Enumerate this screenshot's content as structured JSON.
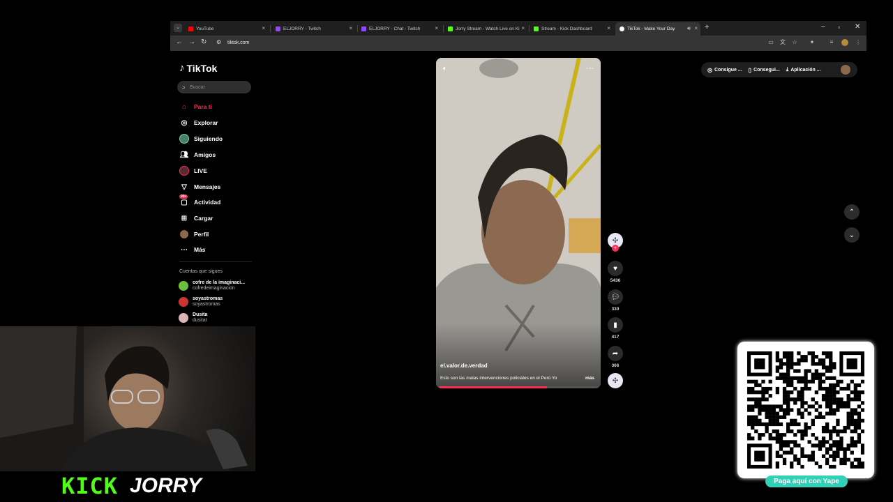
{
  "browser": {
    "tabs": [
      {
        "title": "YouTube",
        "color": "#ff0000",
        "active": false
      },
      {
        "title": "ELJORRY - Twitch",
        "color": "#9146ff",
        "active": false
      },
      {
        "title": "ELJORRY - Chat - Twitch",
        "color": "#9146ff",
        "active": false
      },
      {
        "title": "Jorry Stream - Watch Live on Ki",
        "color": "#53fc18",
        "active": false
      },
      {
        "title": "Stream - Kick Dashboard",
        "color": "#53fc18",
        "active": false
      },
      {
        "title": "TikTok - Make Your Day",
        "color": "#ffffff",
        "active": true
      }
    ],
    "new_tab": "+",
    "url": "tiktok.com"
  },
  "tiktok": {
    "logo_text": "TikTok",
    "search_placeholder": "Buscar",
    "nav": [
      {
        "label": "Para ti",
        "icon": "home-icon",
        "active": true
      },
      {
        "label": "Explorar",
        "icon": "compass-icon",
        "active": false
      },
      {
        "label": "Siguiendo",
        "icon": "following-avatar-icon",
        "active": false
      },
      {
        "label": "Amigos",
        "icon": "friends-icon",
        "active": false
      },
      {
        "label": "LIVE",
        "icon": "live-icon",
        "active": false
      },
      {
        "label": "Mensajes",
        "icon": "messages-icon",
        "active": false
      },
      {
        "label": "Actividad",
        "icon": "activity-icon",
        "active": false,
        "badge": "99+"
      },
      {
        "label": "Cargar",
        "icon": "upload-icon",
        "active": false
      },
      {
        "label": "Perfil",
        "icon": "profile-icon",
        "active": false
      },
      {
        "label": "Más",
        "icon": "more-dots-icon",
        "active": false
      }
    ],
    "following_heading": "Cuentas que sigues",
    "following": [
      {
        "name": "cofre de la imaginaci...",
        "handle": "cofredeimaginacion"
      },
      {
        "name": "soyastromas",
        "handle": "soyastromas"
      },
      {
        "name": "Dusita",
        "handle": "dusitat"
      }
    ],
    "video": {
      "author": "el.valor.de.verdad",
      "caption": "Esto son las malas intervenciones policiales en el Perú Yo",
      "more": "más",
      "progress": 0.68
    },
    "actions": {
      "likes": "5436",
      "comments": "330",
      "saves": "417",
      "shares": "366"
    },
    "top_right": [
      {
        "label": "Consigue ...",
        "icon": "coin-icon"
      },
      {
        "label": "Consegui...",
        "icon": "phone-icon"
      },
      {
        "label": "Aplicación ...",
        "icon": "download-icon"
      }
    ]
  },
  "overlay": {
    "kick_text": "KICK",
    "streamer": "JORRY",
    "yape_label": "Paga aquí con Yape"
  },
  "colors": {
    "accent": "#fe2c55",
    "kick": "#53fc18",
    "yape": "#2fd1b7"
  }
}
